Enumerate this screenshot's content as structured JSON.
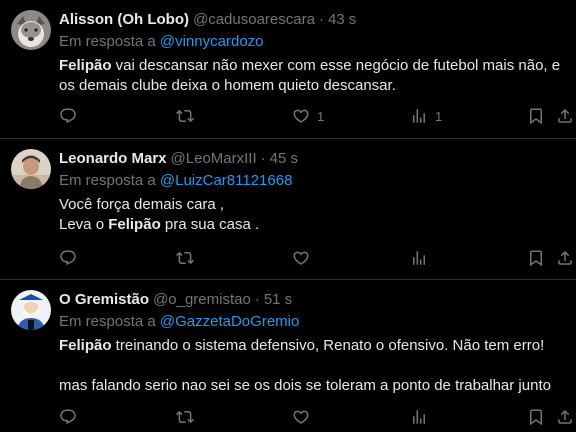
{
  "tweets": [
    {
      "display_name": "Alisson (Oh Lobo)",
      "handle": "@cadusoarescara",
      "dot": "·",
      "time": "43 s",
      "reply_prefix": "Em resposta a ",
      "reply_to": "@vinnycardozo",
      "body_bold": "Felipão",
      "body_rest": " vai descansar não mexer com esse negócio de futebol mais não, e os demais clube deixa o homem quieto descansar.",
      "like_count": "1",
      "view_count": "1",
      "avatar": "wolf-avatar"
    },
    {
      "display_name": "Leonardo Marx",
      "handle": "@LeoMarxIII",
      "dot": "·",
      "time": "45 s",
      "reply_prefix": "Em resposta a ",
      "reply_to": "@LuizCar81121668",
      "line1": "Você força demais cara ,",
      "line2_pre": "Leva o ",
      "line2_bold": "Felipão",
      "line2_post": " pra sua casa .",
      "like_count": "",
      "view_count": "",
      "avatar": "person-avatar"
    },
    {
      "display_name": "O Gremistão",
      "handle": "@o_gremistao",
      "dot": "·",
      "time": "51 s",
      "reply_prefix": "Em resposta a ",
      "reply_to": "@GazzetaDoGremio",
      "body_bold": "Felipão",
      "body_rest": " treinando o sistema defensivo, Renato o ofensivo. Não tem erro!",
      "line2": "mas falando serio nao sei se os dois se toleram a ponto de trabalhar junto",
      "like_count": "",
      "view_count": "",
      "avatar": "mascot-avatar"
    }
  ],
  "colors": {
    "background": "#000000",
    "text": "#e7e9ea",
    "secondary": "#71767b",
    "link": "#1d9bf0",
    "divider": "#2f3336"
  },
  "icons": [
    "reply-icon",
    "retweet-icon",
    "like-icon",
    "views-icon",
    "bookmark-icon",
    "share-icon"
  ]
}
